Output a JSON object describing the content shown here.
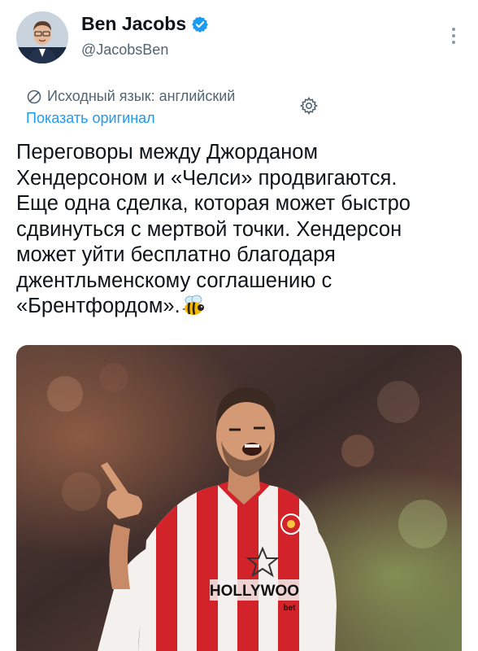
{
  "author": {
    "name": "Ben Jacobs",
    "handle": "@JacobsBen",
    "verified": true,
    "badge_color": "#1d9bf0"
  },
  "translation": {
    "source_language": "Исходный язык: английский",
    "show_original": "Показать оригинал",
    "link_color": "#1d9bf0"
  },
  "tweet": {
    "lines": [
      "Переговоры между Джорданом",
      "Хендерсоном и «Челси» продвигаются.",
      "Еще одна сделка, которая может быстро",
      "сдвинуться с мертвой точки. Хендерсон",
      "может уйти бесплатно благодаря",
      "джентльменскому соглашению с",
      "«Брентфордом»."
    ],
    "emoji": "bee"
  },
  "media": {
    "sponsor_text": "HOLLYWOO",
    "sponsor_sub": "bet",
    "kit_colors": [
      "#d2232a",
      "#ffffff"
    ]
  },
  "icons": [
    "verified-badge-icon",
    "more-options-icon",
    "translate-globe-icon",
    "settings-gear-icon",
    "bee-emoji"
  ]
}
